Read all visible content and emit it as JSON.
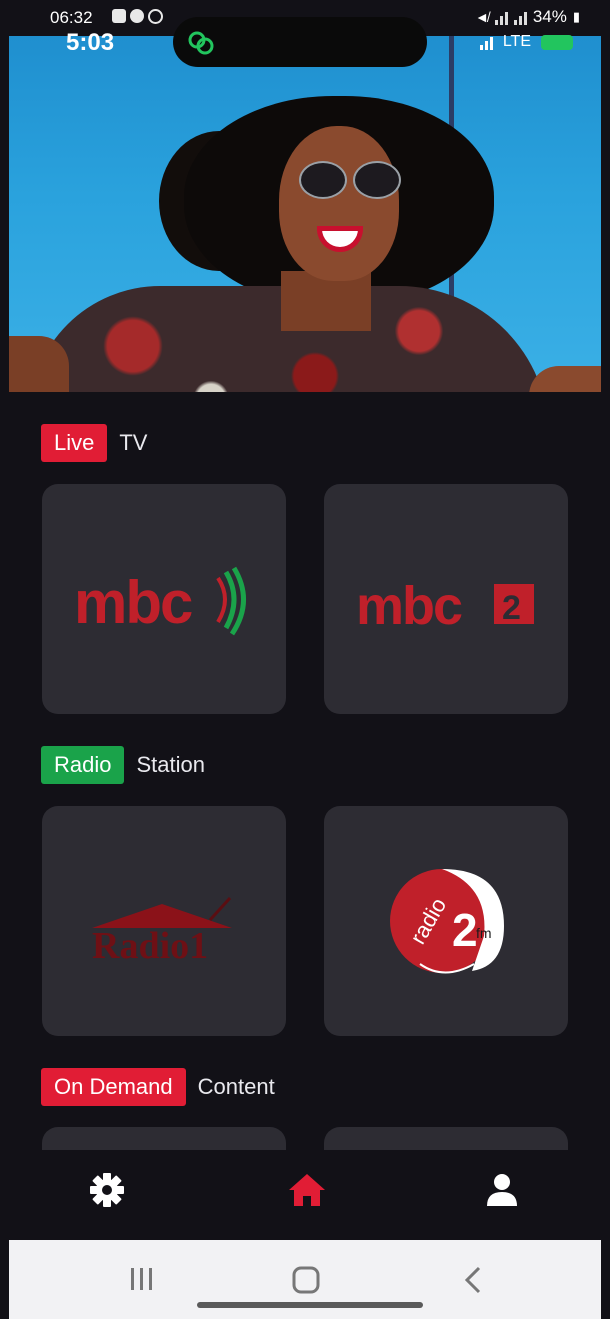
{
  "outer_status": {
    "time": "06:32",
    "battery": "34%"
  },
  "inner_status": {
    "time": "5:03",
    "network": "LTE"
  },
  "sections": {
    "live": {
      "tag": "Live",
      "word": "TV"
    },
    "radio": {
      "tag": "Radio",
      "word": "Station"
    },
    "on_demand": {
      "tag": "On Demand",
      "word": "Content"
    }
  },
  "cards": {
    "mbc1": {
      "brand": "mbc"
    },
    "mbc2": {
      "brand": "mbc",
      "badge": "2"
    },
    "radio1": {
      "brand": "Radio1"
    },
    "radio2": {
      "brand": "radio",
      "badge": "2",
      "suffix": "fm"
    }
  },
  "colors": {
    "accent_red": "#e11d35",
    "accent_green": "#1aa34a",
    "card_bg": "#2d2c33",
    "app_bg": "#121117"
  },
  "icons": [
    "settings-icon",
    "home-icon",
    "profile-icon"
  ]
}
